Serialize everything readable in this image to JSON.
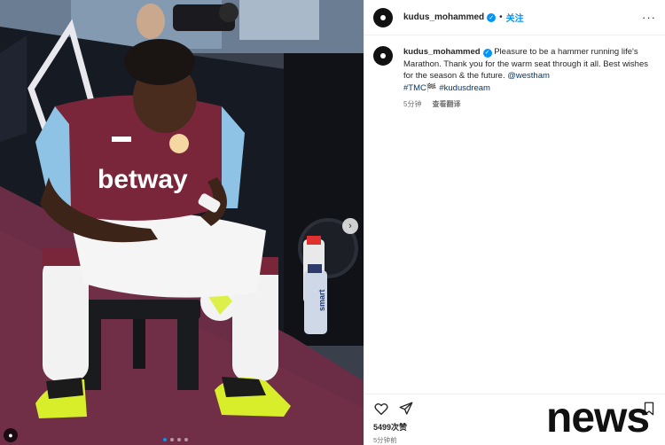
{
  "post": {
    "username": "kudus_mohammed",
    "verified_mark": "✓",
    "separator": "•",
    "follow_label": "关注",
    "more_label": "···",
    "caption_text": "Pleasure to be a hammer running life's Marathon. Thank you for the warm seat through it all. Best wishes for the season & the future.",
    "caption_mention": "@westham",
    "caption_tag_1": "#TMC",
    "caption_flag": "🏁",
    "caption_tag_2": "#kudusdream",
    "caption_age": "5分钟",
    "translate_label": "查看翻译",
    "likes": "5499次赞",
    "timestamp": "5分钟前"
  },
  "media": {
    "jersey_sponsor": "betway",
    "bottle_label": "smart",
    "user_tag_icon": "person-icon",
    "next_icon": "chevron-right-icon",
    "carousel_count": 4,
    "carousel_active_index": 0
  },
  "icons": {
    "like": "heart-icon",
    "share": "paper-plane-icon",
    "save": "bookmark-icon"
  },
  "watermark": {
    "text": "news"
  },
  "colors": {
    "accent_blue": "#0095f6",
    "link_navy": "#00376b",
    "claret": "#7a263a",
    "sky_blue": "#8fc3e6",
    "boot_yellow": "#d8ee2a"
  }
}
